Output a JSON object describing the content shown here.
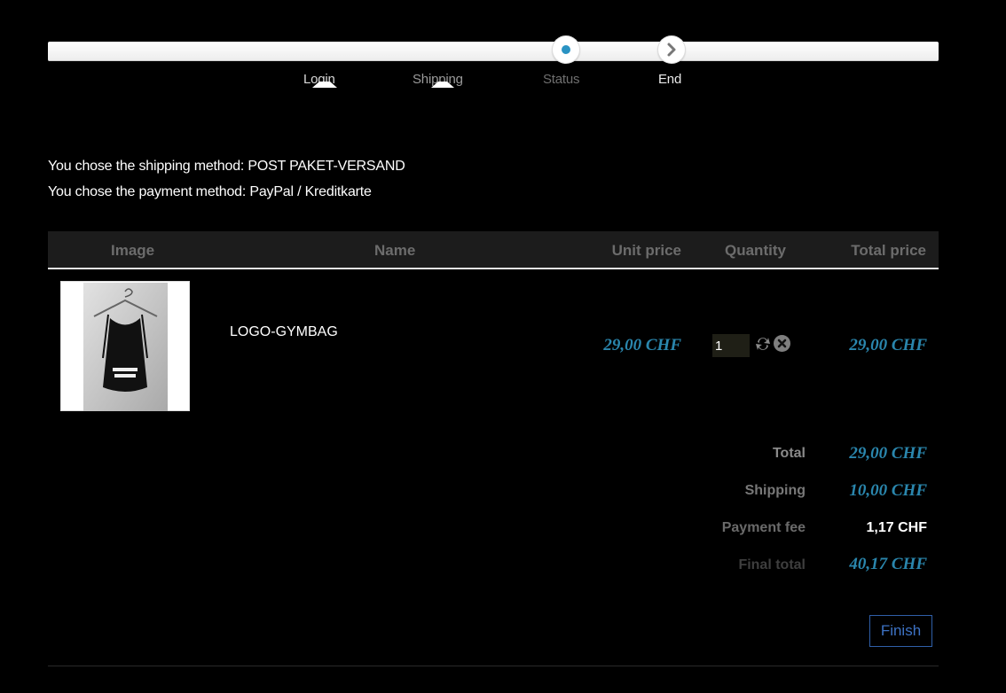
{
  "progress": {
    "steps": [
      {
        "label": "Login",
        "state": "done"
      },
      {
        "label": "Shipping",
        "state": "done"
      },
      {
        "label": "Status",
        "state": "current"
      },
      {
        "label": "End",
        "state": "next"
      }
    ]
  },
  "info": {
    "shipping_line": "You chose the shipping method: POST PAKET-VERSAND",
    "payment_line": "You chose the payment method: PayPal / Kreditkarte"
  },
  "table": {
    "headers": {
      "image": "Image",
      "name": "Name",
      "unit_price": "Unit price",
      "quantity": "Quantity",
      "total_price": "Total price"
    },
    "rows": [
      {
        "name": "LOGO-GYMBAG",
        "unit_price": "29,00 CHF",
        "quantity": "1",
        "total_price": "29,00 CHF"
      }
    ]
  },
  "summary": {
    "total_label": "Total",
    "total_value": "29,00 CHF",
    "shipping_label": "Shipping",
    "shipping_value": "10,00 CHF",
    "fee_label": "Payment fee",
    "fee_value": "1,17 CHF",
    "final_label": "Final total",
    "final_value": "40,17 CHF"
  },
  "actions": {
    "finish_label": "Finish"
  },
  "colors": {
    "accent_price": "#2a86ad",
    "progress_dot": "#2a93c3",
    "finish_border": "#2f5fa8"
  }
}
